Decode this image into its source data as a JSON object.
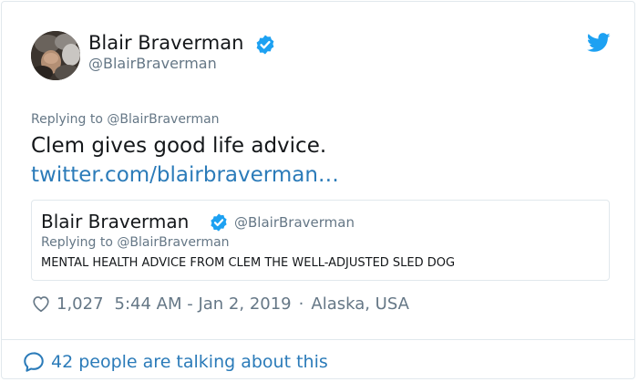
{
  "tweet": {
    "author_name": "Blair Braverman",
    "author_handle": "@BlairBraverman",
    "replying_to": "Replying to @BlairBraverman",
    "text": "Clem gives good life advice.",
    "link": "twitter.com/blairbraverman…",
    "quoted": {
      "author_name": "Blair Braverman",
      "author_handle": "@BlairBraverman",
      "replying_to": "Replying to @BlairBraverman",
      "text": "MENTAL HEALTH ADVICE FROM CLEM THE WELL-ADJUSTED SLED DOG"
    },
    "likes": "1,027",
    "timestamp": "5:44 AM - Jan 2, 2019",
    "separator": "·",
    "location": "Alaska, USA"
  },
  "footer": {
    "talking_text": "42 people are talking about this"
  },
  "icons": {
    "verified": "verified-badge-icon",
    "bird": "twitter-bird-icon",
    "heart": "heart-icon",
    "bubble": "speech-bubble-icon"
  },
  "colors": {
    "link_blue": "#2b7bb9",
    "verified_blue": "#1da1f2",
    "muted": "#657786",
    "text": "#14171a",
    "border": "#e1e8ed"
  }
}
